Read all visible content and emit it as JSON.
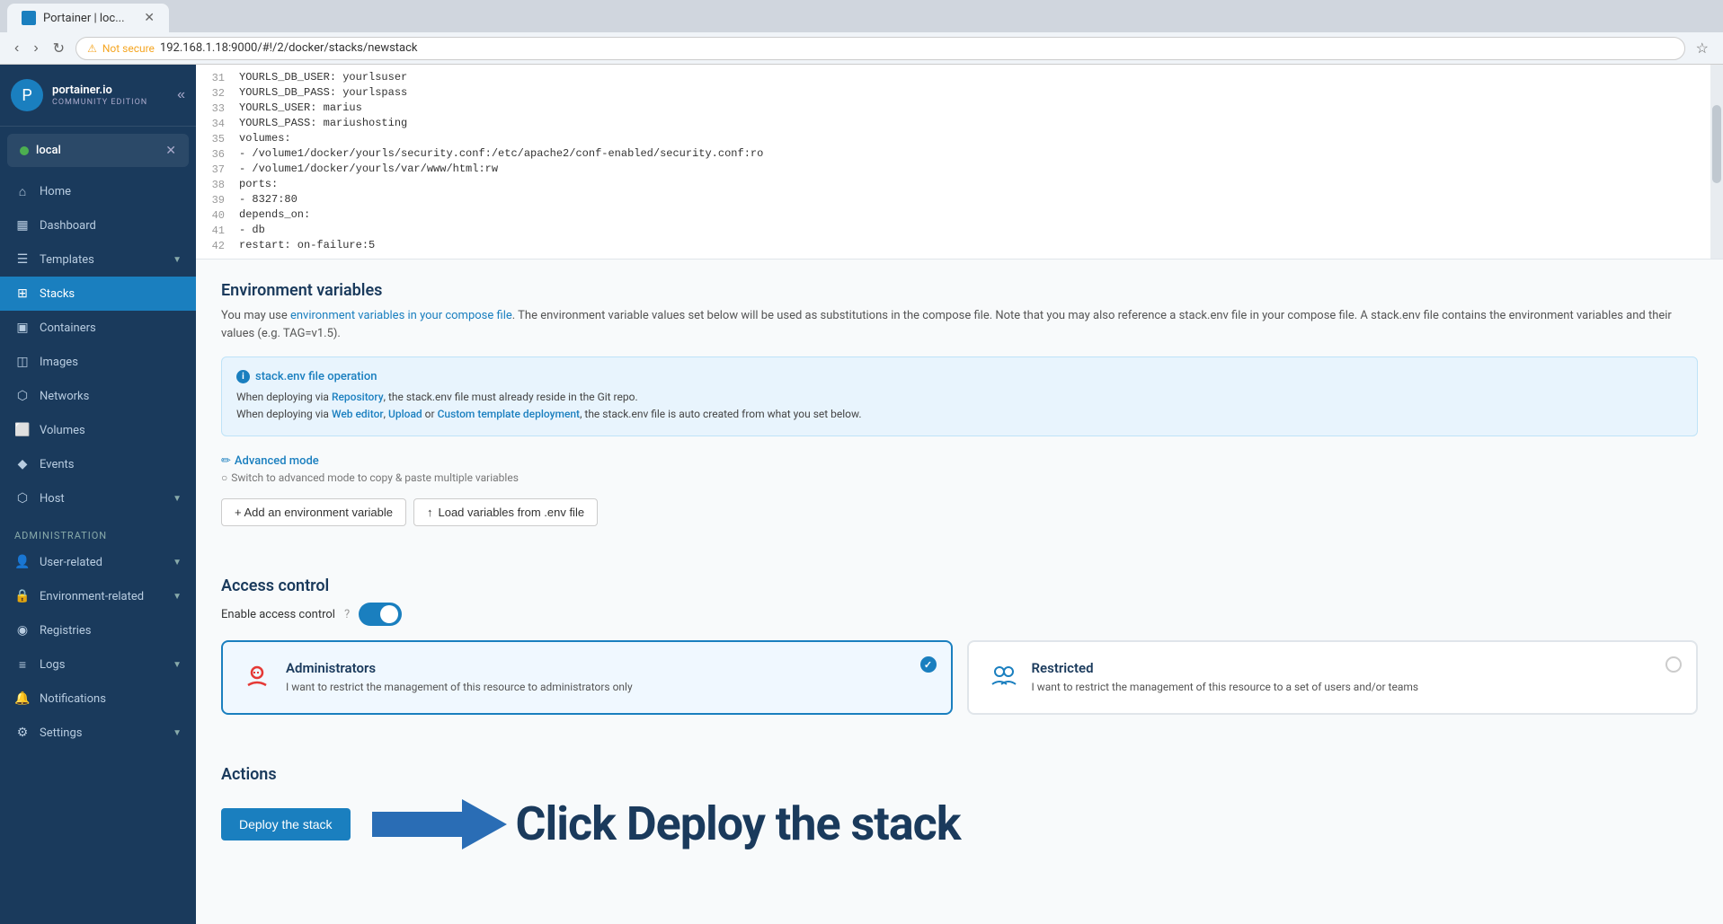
{
  "browser": {
    "tab_label": "Portainer | loc...",
    "url": "192.168.1.18:9000/#!/2/docker/stacks/newstack",
    "not_secure_label": "Not secure"
  },
  "sidebar": {
    "logo_text": "portainer.io",
    "logo_sub": "COMMUNITY EDITION",
    "endpoint_name": "local",
    "nav": {
      "home": "Home",
      "dashboard": "Dashboard",
      "templates": "Templates",
      "stacks": "Stacks",
      "containers": "Containers",
      "images": "Images",
      "networks": "Networks",
      "volumes": "Volumes",
      "events": "Events",
      "host": "Host",
      "administration": "Administration",
      "user_related": "User-related",
      "environment_related": "Environment-related",
      "registries": "Registries",
      "logs": "Logs",
      "notifications": "Notifications",
      "settings": "Settings"
    }
  },
  "code_lines": [
    {
      "num": "31",
      "content": "        YOURLS_DB_USER: yourlsuser"
    },
    {
      "num": "32",
      "content": "        YOURLS_DB_PASS: yourlspass"
    },
    {
      "num": "33",
      "content": "        YOURLS_USER: marius"
    },
    {
      "num": "34",
      "content": "        YOURLS_PASS: mariushosting"
    },
    {
      "num": "35",
      "content": "    volumes:"
    },
    {
      "num": "36",
      "content": "      - /volume1/docker/yourls/security.conf:/etc/apache2/conf-enabled/security.conf:ro"
    },
    {
      "num": "37",
      "content": "      - /volume1/docker/yourls/var/www/html:rw"
    },
    {
      "num": "38",
      "content": "    ports:"
    },
    {
      "num": "39",
      "content": "      - 8327:80"
    },
    {
      "num": "40",
      "content": "    depends_on:"
    },
    {
      "num": "41",
      "content": "      - db"
    },
    {
      "num": "42",
      "content": "    restart: on-failure:5"
    }
  ],
  "env_section": {
    "title": "Environment variables",
    "description_start": "You may use ",
    "description_link": "environment variables in your compose file",
    "description_end": ". The environment variable values set below will be used as substitutions in the compose file. Note that you may also reference a stack.env file in your compose file. A stack.env file contains the environment variables and their values (e.g. TAG=v1.5).",
    "info_box_title": "stack.env file operation",
    "info_line1_start": "When deploying via ",
    "info_line1_link": "Repository",
    "info_line1_end": ", the stack.env file must already reside in the Git repo.",
    "info_line2_start": "When deploying via ",
    "info_line2_link1": "Web editor",
    "info_line2_sep1": ", ",
    "info_line2_link2": "Upload",
    "info_line2_sep2": " or ",
    "info_line2_link3": "Custom template deployment",
    "info_line2_end": ", the stack.env file is auto created from what you set below.",
    "advanced_mode_label": "Advanced mode",
    "switch_hint": "Switch to advanced mode to copy & paste multiple variables",
    "add_env_btn": "+ Add an environment variable",
    "load_vars_btn": "Load variables from .env file"
  },
  "access_control": {
    "title": "Access control",
    "enable_label": "Enable access control",
    "admin_card": {
      "title": "Administrators",
      "description": "I want to restrict the management of this resource to administrators only"
    },
    "restricted_card": {
      "title": "Restricted",
      "description": "I want to restrict the management of this resource to a set of users and/or teams"
    }
  },
  "actions": {
    "title": "Actions",
    "deploy_btn": "Deploy the stack",
    "click_annotation": "Click Deploy the stack"
  }
}
